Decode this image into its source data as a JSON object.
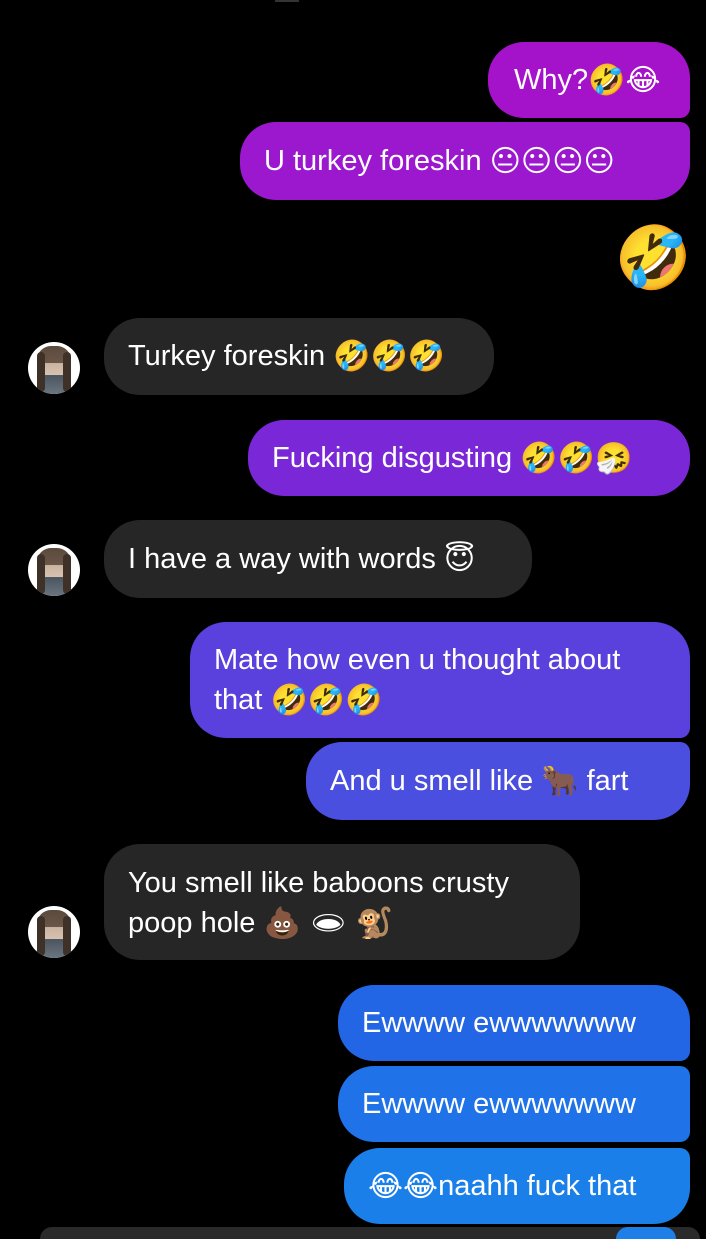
{
  "thread": {
    "messages": [
      {
        "id": "m1",
        "direction": "outgoing",
        "text": "Why?",
        "emoji": "🤣😂",
        "color": "#a413c9"
      },
      {
        "id": "m2",
        "direction": "outgoing",
        "text": "U turkey foreskin ",
        "emoji": "😐😐😐😐",
        "color": "#9c18cf"
      },
      {
        "id": "m3",
        "direction": "outgoing",
        "text": "",
        "emoji": "😂🤣",
        "type": "emoji-only"
      },
      {
        "id": "m4",
        "direction": "incoming",
        "text": "Turkey foreskin ",
        "emoji": "🤣🤣🤣",
        "color": "#262626"
      },
      {
        "id": "m5",
        "direction": "outgoing",
        "text": "Fucking disgusting ",
        "emoji": "🤣🤣🤧",
        "color": "#7a27d8"
      },
      {
        "id": "m6",
        "direction": "incoming",
        "text": "I have a way with words ",
        "emoji": "😇",
        "color": "#262626"
      },
      {
        "id": "m7",
        "direction": "outgoing",
        "line1": "Mate how even u thought about",
        "line2": "that ",
        "emoji": "🤣🤣🤣",
        "color": "#5a40dc"
      },
      {
        "id": "m8",
        "direction": "outgoing",
        "text": "And u smell like ",
        "emoji": "🐂",
        "text_after": " fart",
        "color": "#4a4fe0"
      },
      {
        "id": "m9",
        "direction": "incoming",
        "line1": "You smell like baboons crusty",
        "line2": "poop hole ",
        "emoji": "💩 🕳 🐒",
        "color": "#262626"
      },
      {
        "id": "m10",
        "direction": "outgoing",
        "text": "Ewwww ewwwwwww",
        "color": "#2266e6"
      },
      {
        "id": "m11",
        "direction": "outgoing",
        "text": "Ewwww ewwwwwww",
        "color": "#1f72e8"
      },
      {
        "id": "m12",
        "direction": "outgoing",
        "text": "naahh fuck that",
        "emoji": "😂😂",
        "color": "#1b7fe9"
      }
    ]
  },
  "colors": {
    "background": "#000000",
    "incoming_bubble": "#262626",
    "text": "#ffffff"
  }
}
